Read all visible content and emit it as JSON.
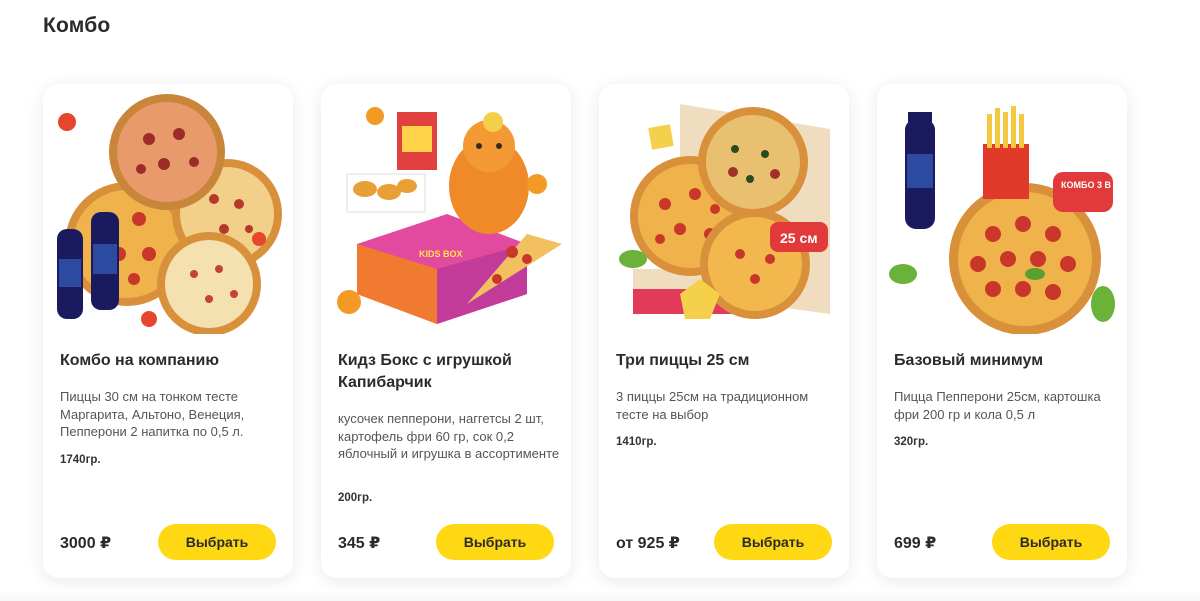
{
  "section": {
    "title": "Комбо"
  },
  "colors": {
    "button": "#ffd814",
    "text": "#2b2b2b",
    "muted": "#555555"
  },
  "products": [
    {
      "title": "Комбо на компанию",
      "description": "Пиццы 30 см на тонком тесте Маргарита, Альтоно, Венеция, Пепперони 2 напитка по 0,5 л.",
      "weight": "1740гр.",
      "price": "3000 ₽",
      "button": "Выбрать",
      "image": "four-pizzas-and-cola-image"
    },
    {
      "title": "Кидз Бокс с игрушкой Капибарчик",
      "description": "кусочек пепперони, наггетсы 2 шт, картофель фри 60 гр, сок 0,2 яблочный и игрушка в ассортименте",
      "weight": "200гр.",
      "price": "345 ₽",
      "button": "Выбрать",
      "image": "kids-box-capybara-image",
      "badge": "KIDS BOX"
    },
    {
      "title": "Три пиццы 25 см",
      "description": "3 пиццы 25см на традиционном тесте на выбор",
      "weight": "1410гр.",
      "price": "от 925 ₽",
      "button": "Выбрать",
      "image": "three-pizzas-box-image",
      "badge": "25 см"
    },
    {
      "title": "Базовый минимум",
      "description": "Пицца Пепперони 25см, картошка фри 200 гр и кола 0,5 л",
      "weight": "320гр.",
      "price": "699 ₽",
      "button": "Выбрать",
      "image": "pepperoni-fries-cola-image",
      "badge": "КОМБО 3 В 1"
    }
  ]
}
